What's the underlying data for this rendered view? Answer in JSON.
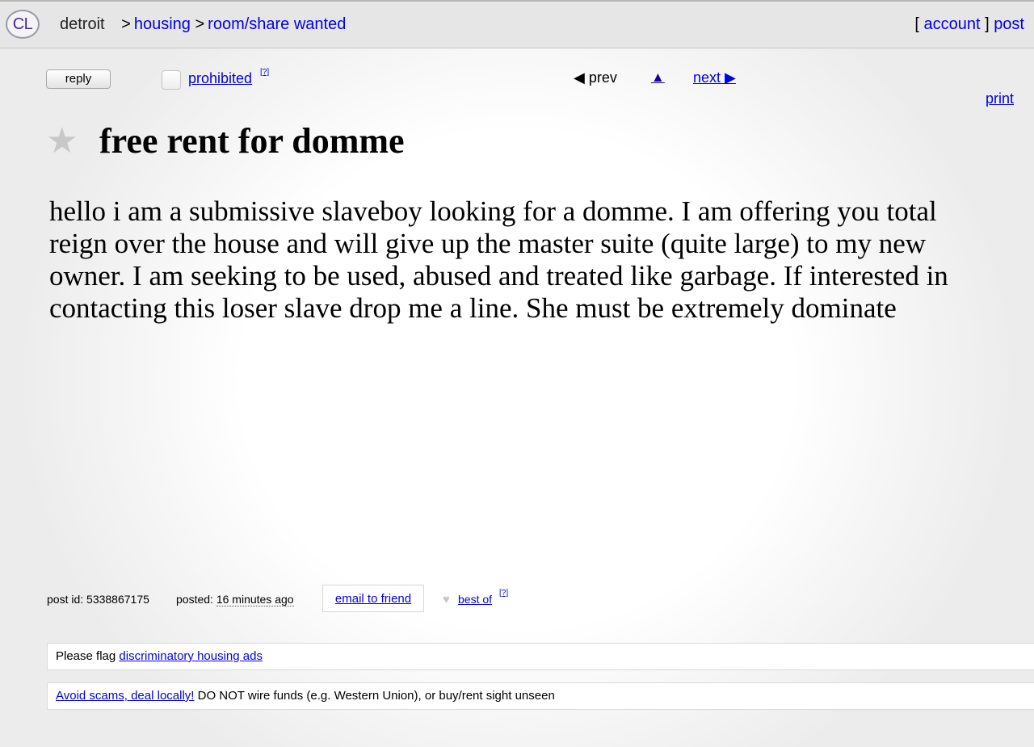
{
  "header": {
    "logo": "CL",
    "city": "detroit",
    "breadcrumbs": [
      {
        "sep": ">",
        "label": "housing"
      },
      {
        "sep": ">",
        "label": "room/share wanted"
      }
    ],
    "account_label": "account",
    "post_label": "post"
  },
  "toolbar": {
    "reply_label": "reply",
    "prohibited_label": "prohibited",
    "help_label": "[?]",
    "prev_label": "prev",
    "next_label": "next",
    "print_label": "print"
  },
  "posting": {
    "title": "free rent for domme",
    "body": "hello i am a submissive slaveboy looking for a domme. I am offering you total reign over the house and will give up the master suite (quite large) to my new owner. I am seeking to be used, abused and treated like garbage. If interested in contacting this loser slave drop me a line. She must be extremely dominate"
  },
  "meta": {
    "post_id_label": "post id:",
    "post_id": "5338867175",
    "posted_label": "posted:",
    "posted_value": "16 minutes ago",
    "email_label": "email to friend",
    "best_of_label": "best of",
    "help_label": "[?]"
  },
  "notices": {
    "flag_prefix": "Please flag",
    "flag_link": "discriminatory housing ads",
    "scam_link": "Avoid scams, deal locally!",
    "scam_text": "DO NOT wire funds (e.g. Western Union), or buy/rent sight unseen"
  },
  "icons": {
    "star": "star-icon",
    "prev": "triangle-left-icon",
    "up": "triangle-up-icon",
    "next": "triangle-right-icon",
    "heart": "heart-icon"
  }
}
